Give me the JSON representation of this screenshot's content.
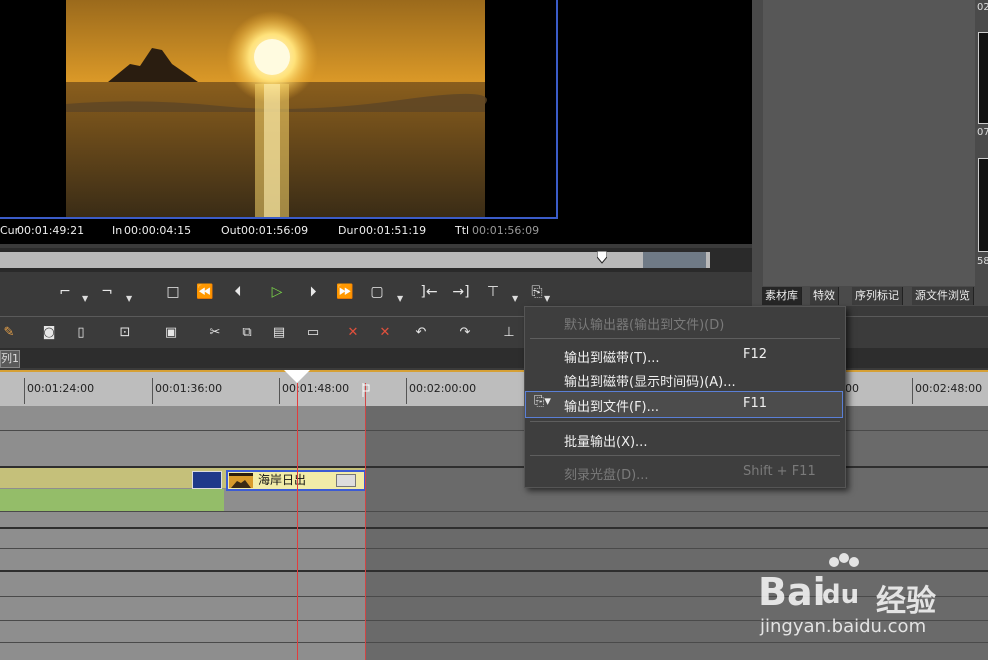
{
  "player": {
    "cur_label": "Cur",
    "cur_value": "00:01:49:21",
    "in_label": "In",
    "in_value": "00:00:04:15",
    "out_label": "Out",
    "out_value": "00:01:56:09",
    "dur_label": "Dur",
    "dur_value": "00:01:51:19",
    "ttl_label": "Ttl",
    "ttl_value": "00:01:56:09"
  },
  "right_panel": {
    "tabs": [
      "素材库",
      "特效",
      "序列标记",
      "源文件浏览"
    ],
    "thumb_labels": [
      "02",
      "07",
      "58"
    ]
  },
  "sequence": {
    "tab_label": "列1"
  },
  "ruler": {
    "labels": [
      "00:01:24:00",
      "00:01:36:00",
      "00:01:48:00",
      "00:02:00:00",
      "00",
      "00:02:48:00"
    ]
  },
  "timeline": {
    "clip_name": "海岸日出"
  },
  "menu": {
    "items": [
      {
        "label": "默认输出器(输出到文件)(D)",
        "shortcut": "",
        "disabled": true
      },
      {
        "label": "输出到磁带(T)...",
        "shortcut": "F12",
        "disabled": false
      },
      {
        "label": "输出到磁带(显示时间码)(A)...",
        "shortcut": "",
        "disabled": false
      },
      {
        "label": "输出到文件(F)...",
        "shortcut": "F11",
        "disabled": false,
        "highlighted": true
      },
      {
        "label": "批量输出(X)...",
        "shortcut": "",
        "disabled": false
      },
      {
        "label": "刻录光盘(D)...",
        "shortcut": "Shift + F11",
        "disabled": true
      }
    ]
  },
  "watermark": {
    "brand_a": "Bai",
    "brand_b": "du",
    "brand_c": "经验",
    "url": "jingyan.baidu.com"
  }
}
